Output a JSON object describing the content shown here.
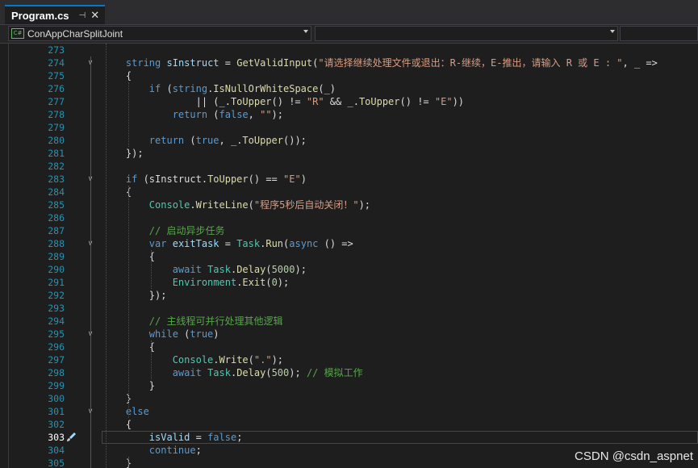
{
  "tab": {
    "title": "Program.cs",
    "pin_icon": "pin-icon",
    "close_icon": "close-icon"
  },
  "navbar": {
    "project": "ConAppCharSplitJoint",
    "type_member": "",
    "extra": "",
    "project_icon": "csharp-project-icon"
  },
  "editor": {
    "current_line": "303",
    "lines": [
      {
        "n": "273",
        "fold": "",
        "tokens": []
      },
      {
        "n": "274",
        "fold": "∨",
        "tokens": [
          [
            "    ",
            "p"
          ],
          [
            "string",
            "k"
          ],
          [
            " ",
            "p"
          ],
          [
            "sInstruct",
            "v"
          ],
          [
            " = ",
            "p"
          ],
          [
            "GetValidInput",
            "m"
          ],
          [
            "(",
            "p"
          ],
          [
            "\"请选择继续处理文件或退出：R-继续，E-推出，请输入 R 或 E : \"",
            "s"
          ],
          [
            ", _ =>",
            "p"
          ]
        ]
      },
      {
        "n": "275",
        "fold": "",
        "tokens": [
          [
            "    {",
            "p"
          ]
        ]
      },
      {
        "n": "276",
        "fold": "",
        "tokens": [
          [
            "        ",
            "p"
          ],
          [
            "if",
            "k"
          ],
          [
            " (",
            "p"
          ],
          [
            "string",
            "k"
          ],
          [
            ".",
            "p"
          ],
          [
            "IsNullOrWhiteSpace",
            "m"
          ],
          [
            "(_)",
            "p"
          ]
        ]
      },
      {
        "n": "277",
        "fold": "",
        "tokens": [
          [
            "                || (_.",
            "p"
          ],
          [
            "ToUpper",
            "m"
          ],
          [
            "() != ",
            "p"
          ],
          [
            "\"R\"",
            "s"
          ],
          [
            " && _.",
            "p"
          ],
          [
            "ToUpper",
            "m"
          ],
          [
            "() != ",
            "p"
          ],
          [
            "\"E\"",
            "s"
          ],
          [
            "))",
            "p"
          ]
        ]
      },
      {
        "n": "278",
        "fold": "",
        "tokens": [
          [
            "            ",
            "p"
          ],
          [
            "return",
            "k"
          ],
          [
            " (",
            "p"
          ],
          [
            "false",
            "k"
          ],
          [
            ", ",
            "p"
          ],
          [
            "\"\"",
            "s"
          ],
          [
            ");",
            "p"
          ]
        ]
      },
      {
        "n": "279",
        "fold": "",
        "tokens": []
      },
      {
        "n": "280",
        "fold": "",
        "tokens": [
          [
            "        ",
            "p"
          ],
          [
            "return",
            "k"
          ],
          [
            " (",
            "p"
          ],
          [
            "true",
            "k"
          ],
          [
            ", _.",
            "p"
          ],
          [
            "ToUpper",
            "m"
          ],
          [
            "());",
            "p"
          ]
        ]
      },
      {
        "n": "281",
        "fold": "",
        "tokens": [
          [
            "    });",
            "p"
          ]
        ]
      },
      {
        "n": "282",
        "fold": "",
        "tokens": []
      },
      {
        "n": "283",
        "fold": "∨",
        "tokens": [
          [
            "    ",
            "p"
          ],
          [
            "if",
            "k"
          ],
          [
            " (sInstruct.",
            "p"
          ],
          [
            "ToUpper",
            "m"
          ],
          [
            "() == ",
            "p"
          ],
          [
            "\"E\"",
            "s"
          ],
          [
            ")",
            "p"
          ]
        ]
      },
      {
        "n": "284",
        "fold": "",
        "tokens": [
          [
            "    {",
            "p"
          ]
        ]
      },
      {
        "n": "285",
        "fold": "",
        "tokens": [
          [
            "        ",
            "p"
          ],
          [
            "Console",
            "t"
          ],
          [
            ".",
            "p"
          ],
          [
            "WriteLine",
            "m"
          ],
          [
            "(",
            "p"
          ],
          [
            "\"程序5秒后自动关闭！\"",
            "s"
          ],
          [
            ");",
            "p"
          ]
        ]
      },
      {
        "n": "286",
        "fold": "",
        "tokens": []
      },
      {
        "n": "287",
        "fold": "",
        "tokens": [
          [
            "        ",
            "p"
          ],
          [
            "// 启动异步任务",
            "c"
          ]
        ]
      },
      {
        "n": "288",
        "fold": "∨",
        "tokens": [
          [
            "        ",
            "p"
          ],
          [
            "var",
            "k"
          ],
          [
            " ",
            "p"
          ],
          [
            "exitTask",
            "v"
          ],
          [
            " = ",
            "p"
          ],
          [
            "Task",
            "t"
          ],
          [
            ".",
            "p"
          ],
          [
            "Run",
            "m"
          ],
          [
            "(",
            "p"
          ],
          [
            "async",
            "k"
          ],
          [
            " () =>",
            "p"
          ]
        ]
      },
      {
        "n": "289",
        "fold": "",
        "tokens": [
          [
            "        {",
            "p"
          ]
        ]
      },
      {
        "n": "290",
        "fold": "",
        "tokens": [
          [
            "            ",
            "p"
          ],
          [
            "await",
            "k"
          ],
          [
            " ",
            "p"
          ],
          [
            "Task",
            "t"
          ],
          [
            ".",
            "p"
          ],
          [
            "Delay",
            "m"
          ],
          [
            "(",
            "p"
          ],
          [
            "5000",
            "n"
          ],
          [
            ");",
            "p"
          ]
        ]
      },
      {
        "n": "291",
        "fold": "",
        "tokens": [
          [
            "            ",
            "p"
          ],
          [
            "Environment",
            "t"
          ],
          [
            ".",
            "p"
          ],
          [
            "Exit",
            "m"
          ],
          [
            "(",
            "p"
          ],
          [
            "0",
            "n"
          ],
          [
            ");",
            "p"
          ]
        ]
      },
      {
        "n": "292",
        "fold": "",
        "tokens": [
          [
            "        });",
            "p"
          ]
        ]
      },
      {
        "n": "293",
        "fold": "",
        "tokens": []
      },
      {
        "n": "294",
        "fold": "",
        "tokens": [
          [
            "        ",
            "p"
          ],
          [
            "// 主线程可并行处理其他逻辑",
            "c"
          ]
        ]
      },
      {
        "n": "295",
        "fold": "∨",
        "tokens": [
          [
            "        ",
            "p"
          ],
          [
            "while",
            "k"
          ],
          [
            " (",
            "p"
          ],
          [
            "true",
            "k"
          ],
          [
            ")",
            "p"
          ]
        ]
      },
      {
        "n": "296",
        "fold": "",
        "tokens": [
          [
            "        {",
            "p"
          ]
        ]
      },
      {
        "n": "297",
        "fold": "",
        "tokens": [
          [
            "            ",
            "p"
          ],
          [
            "Console",
            "t"
          ],
          [
            ".",
            "p"
          ],
          [
            "Write",
            "m"
          ],
          [
            "(",
            "p"
          ],
          [
            "\".\"",
            "s"
          ],
          [
            ");",
            "p"
          ]
        ]
      },
      {
        "n": "298",
        "fold": "",
        "tokens": [
          [
            "            ",
            "p"
          ],
          [
            "await",
            "k"
          ],
          [
            " ",
            "p"
          ],
          [
            "Task",
            "t"
          ],
          [
            ".",
            "p"
          ],
          [
            "Delay",
            "m"
          ],
          [
            "(",
            "p"
          ],
          [
            "500",
            "n"
          ],
          [
            "); ",
            "p"
          ],
          [
            "// 模拟工作",
            "c"
          ]
        ]
      },
      {
        "n": "299",
        "fold": "",
        "tokens": [
          [
            "        }",
            "p"
          ]
        ]
      },
      {
        "n": "300",
        "fold": "",
        "tokens": [
          [
            "    }",
            "p"
          ]
        ]
      },
      {
        "n": "301",
        "fold": "∨",
        "tokens": [
          [
            "    ",
            "p"
          ],
          [
            "else",
            "k"
          ]
        ]
      },
      {
        "n": "302",
        "fold": "",
        "tokens": [
          [
            "    {",
            "p"
          ]
        ]
      },
      {
        "n": "303",
        "fold": "",
        "tokens": [
          [
            "        ",
            "p"
          ],
          [
            "isValid",
            "v"
          ],
          [
            " = ",
            "p"
          ],
          [
            "false",
            "k"
          ],
          [
            ";",
            "p"
          ]
        ]
      },
      {
        "n": "304",
        "fold": "",
        "tokens": [
          [
            "        ",
            "p"
          ],
          [
            "continue",
            "k"
          ],
          [
            ";",
            "p"
          ]
        ]
      },
      {
        "n": "305",
        "fold": "",
        "tokens": [
          [
            "    }",
            "p"
          ]
        ]
      }
    ]
  },
  "watermark": "CSDN @csdn_aspnet",
  "colors": {
    "background": "#1e1e1e",
    "keyword": "#569cd6",
    "type": "#4ec9b0",
    "method": "#dcdcaa",
    "variable": "#9cdcfe",
    "string": "#d69d85",
    "comment": "#57a64a",
    "number": "#b5cea8",
    "line_number": "#2b91af"
  }
}
